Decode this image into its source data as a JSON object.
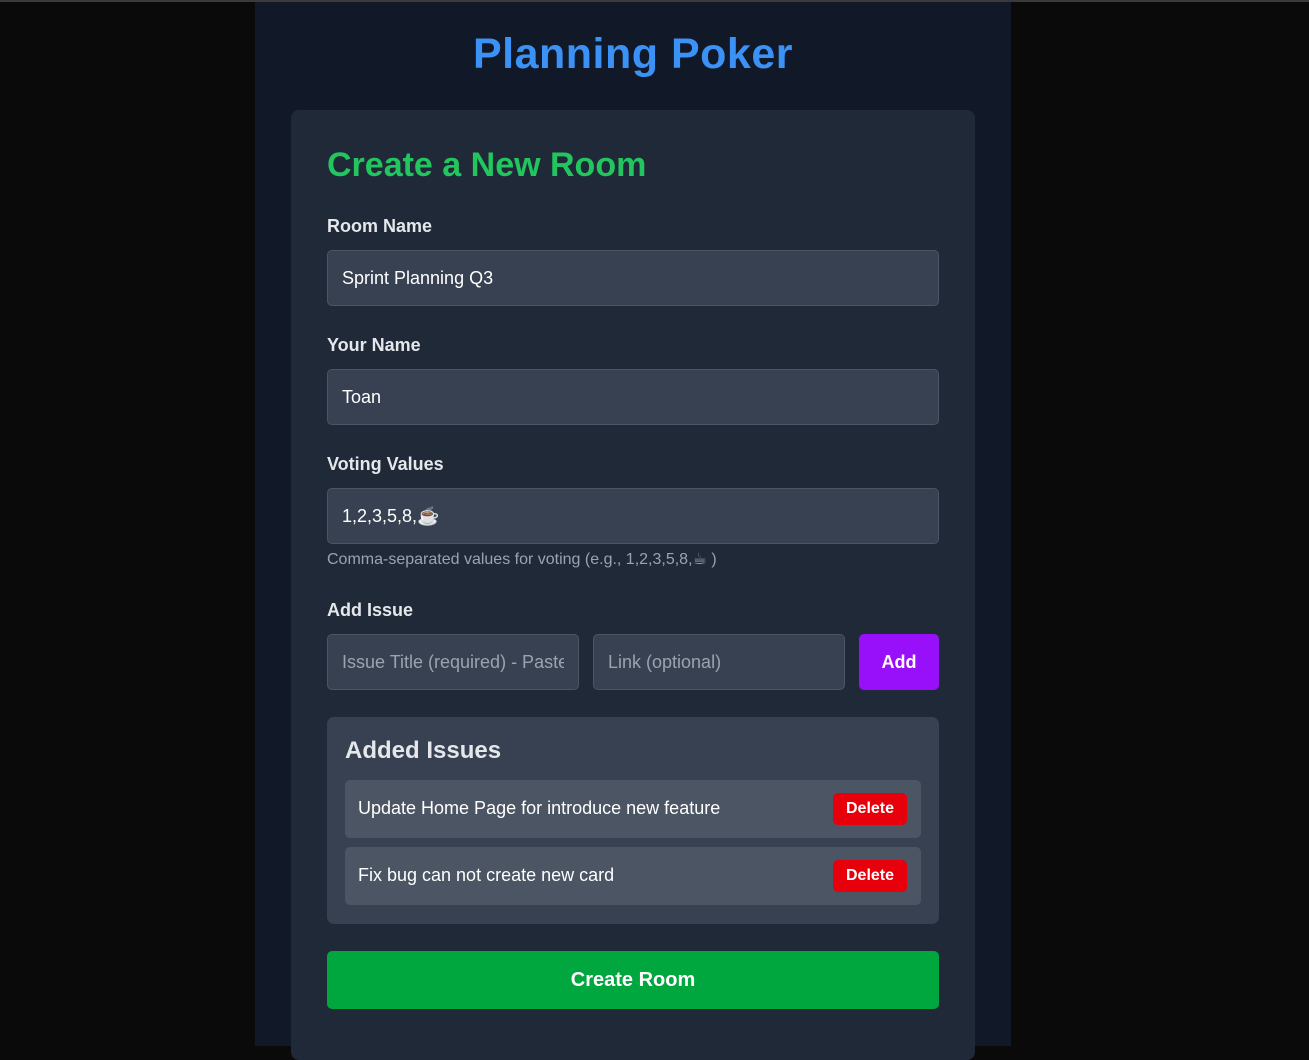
{
  "app": {
    "title": "Planning Poker"
  },
  "form": {
    "heading": "Create a New Room",
    "room_name": {
      "label": "Room Name",
      "value": "Sprint Planning Q3"
    },
    "your_name": {
      "label": "Your Name",
      "value": "Toan"
    },
    "voting_values": {
      "label": "Voting Values",
      "value": "1,2,3,5,8,☕",
      "hint": "Comma-separated values for voting (e.g., 1,2,3,5,8,☕ )"
    },
    "add_issue": {
      "label": "Add Issue",
      "title_placeholder": "Issue Title (required) - Paste",
      "link_placeholder": "Link (optional)",
      "add_label": "Add"
    },
    "added_issues": {
      "heading": "Added Issues",
      "delete_label": "Delete",
      "items": [
        {
          "title": "Update Home Page for introduce new feature"
        },
        {
          "title": "Fix bug can not create new card"
        }
      ]
    },
    "create_label": "Create Room"
  },
  "colors": {
    "title": "#3b92f6",
    "heading": "#22c55e",
    "add_button": "#9810fa",
    "delete_button": "#e7000b",
    "create_button": "#00a63e"
  }
}
